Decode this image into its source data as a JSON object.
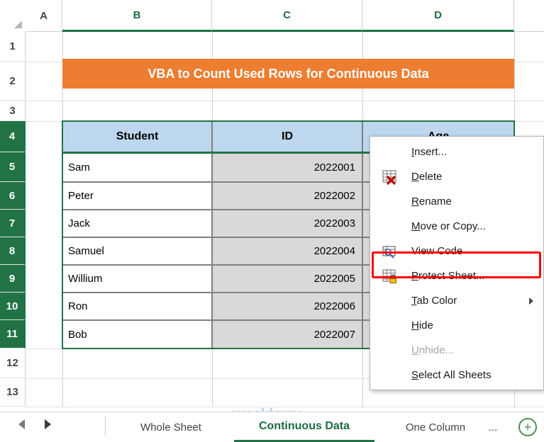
{
  "spreadsheet": {
    "columns": [
      {
        "label": "A",
        "selected": false
      },
      {
        "label": "B",
        "selected": true
      },
      {
        "label": "C",
        "selected": true
      },
      {
        "label": "D",
        "selected": true
      }
    ],
    "rows": [
      {
        "label": "1",
        "selected": false
      },
      {
        "label": "2",
        "selected": false
      },
      {
        "label": "3",
        "selected": false
      },
      {
        "label": "4",
        "selected": true
      },
      {
        "label": "5",
        "selected": true
      },
      {
        "label": "6",
        "selected": true
      },
      {
        "label": "7",
        "selected": true
      },
      {
        "label": "8",
        "selected": true
      },
      {
        "label": "9",
        "selected": true
      },
      {
        "label": "10",
        "selected": true
      },
      {
        "label": "11",
        "selected": true
      },
      {
        "label": "12",
        "selected": false
      },
      {
        "label": "13",
        "selected": false
      }
    ],
    "title_banner": "VBA to Count Used Rows for Continuous Data",
    "table": {
      "headers": [
        "Student",
        "ID",
        "Age"
      ],
      "rows": [
        {
          "student": "Sam",
          "id": "2022001",
          "age": ""
        },
        {
          "student": "Peter",
          "id": "2022002",
          "age": ""
        },
        {
          "student": "Jack",
          "id": "2022003",
          "age": ""
        },
        {
          "student": "Samuel",
          "id": "2022004",
          "age": ""
        },
        {
          "student": "Willium",
          "id": "2022005",
          "age": ""
        },
        {
          "student": "Ron",
          "id": "2022006",
          "age": ""
        },
        {
          "student": "Bob",
          "id": "2022007",
          "age": ""
        }
      ]
    },
    "colors": {
      "banner": "#ED7D31",
      "header_fill": "#BDD7EE",
      "data_fill": "#D9D9D9",
      "selection": "#217346",
      "highlight": "#FF0000"
    }
  },
  "context_menu": {
    "items": [
      {
        "label": "Insert...",
        "icon": "",
        "disabled": false,
        "submenu": false,
        "highlighted": false
      },
      {
        "label": "Delete",
        "icon": "delete-sheet-icon",
        "disabled": false,
        "submenu": false,
        "highlighted": false
      },
      {
        "label": "Rename",
        "icon": "",
        "disabled": false,
        "submenu": false,
        "highlighted": false
      },
      {
        "label": "Move or Copy...",
        "icon": "",
        "disabled": false,
        "submenu": false,
        "highlighted": false
      },
      {
        "label": "View Code",
        "icon": "view-code-icon",
        "disabled": false,
        "submenu": false,
        "highlighted": true
      },
      {
        "label": "Protect Sheet...",
        "icon": "protect-sheet-icon",
        "disabled": false,
        "submenu": false,
        "highlighted": false
      },
      {
        "label": "Tab Color",
        "icon": "",
        "disabled": false,
        "submenu": true,
        "highlighted": false
      },
      {
        "label": "Hide",
        "icon": "",
        "disabled": false,
        "submenu": false,
        "highlighted": false
      },
      {
        "label": "Unhide...",
        "icon": "",
        "disabled": true,
        "submenu": false,
        "highlighted": false
      },
      {
        "label": "Select All Sheets",
        "icon": "",
        "disabled": false,
        "submenu": false,
        "highlighted": false
      }
    ]
  },
  "tabbar": {
    "prev_arrow": "prev-sheet-arrow",
    "next_arrow": "next-sheet-arrow",
    "tabs": [
      {
        "label": "Whole Sheet",
        "active": false
      },
      {
        "label": "Continuous Data",
        "active": true
      },
      {
        "label": "One Column",
        "active": false
      },
      {
        "label": "...",
        "active": false
      }
    ],
    "add_sheet_label": "+"
  },
  "watermark": {
    "text": "exceldemy"
  }
}
